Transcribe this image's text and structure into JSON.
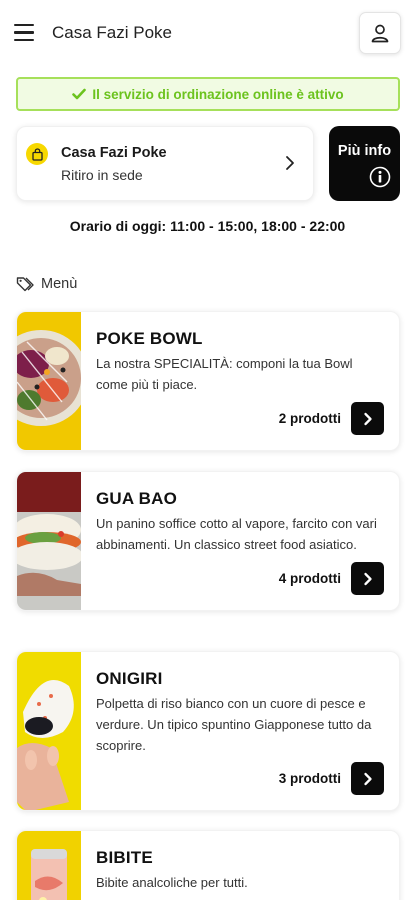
{
  "header": {
    "title": "Casa Fazi Poke",
    "menu_icon": "hamburger-icon",
    "user_icon": "user-icon"
  },
  "status": {
    "text": "Il servizio di ordinazione online è attivo",
    "color": "#6cc31e"
  },
  "restaurant": {
    "name": "Casa Fazi Poke",
    "mode": "Ritiro in sede"
  },
  "more_info": {
    "label": "Più info"
  },
  "hours": {
    "text": "Orario di oggi: 11:00 - 15:00, 18:00 - 22:00"
  },
  "menu": {
    "label": "Menù",
    "categories": [
      {
        "name": "POKE BOWL",
        "description": "La nostra SPECIALITÀ: componi la tua Bowl come più ti piace.",
        "count": "2 prodotti"
      },
      {
        "name": "GUA BAO",
        "description": "Un panino soffice cotto al vapore, farcito con vari abbinamenti. Un classico street food asiatico.",
        "count": "4 prodotti"
      },
      {
        "name": "ONIGIRI",
        "description": "Polpetta di riso bianco con un cuore di pesce e verdure. Un tipico spuntino Giapponese tutto da scoprire.",
        "count": "3 prodotti"
      },
      {
        "name": "BIBITE",
        "description": "Bibite analcoliche per tutti.",
        "count": ""
      }
    ]
  },
  "colors": {
    "accent_yellow": "#f7d800",
    "banner_border": "#a6e05a",
    "dark": "#0a0a0a"
  }
}
